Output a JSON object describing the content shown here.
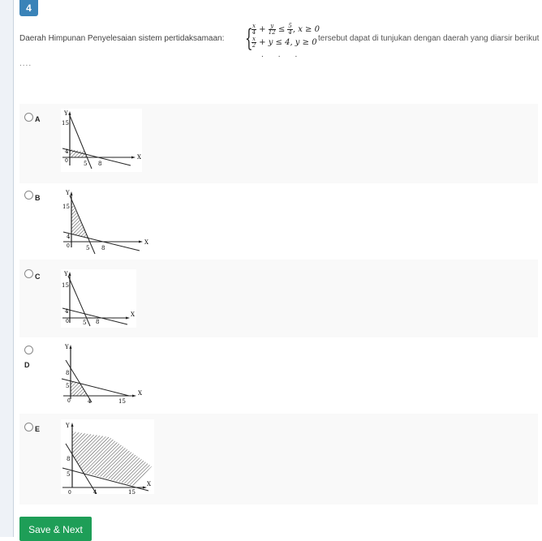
{
  "question": {
    "number": "4",
    "lead": "Daerah Himpunan Penyelesaian sistem pertidaksamaan:",
    "system": {
      "line1": {
        "t1_num": "x",
        "t1_den": "4",
        "plus": "+",
        "t2_num": "y",
        "t2_den": "12",
        "rel": "≤",
        "rhs_num": "5",
        "rhs_den": "4",
        "extra": ", x ≥ 0"
      },
      "line2": {
        "t1_num": "x",
        "t1_den": "2",
        "rest": "+ y ≤ 4",
        "extra": ", y ≥ 0"
      }
    },
    "tail": "tersebut dapat di tunjukan dengan daerah yang diarsir berikut",
    "ellipsis": "....",
    "system_dots": "..."
  },
  "options": [
    {
      "letter": "A",
      "graph": {
        "y_label": "Y",
        "x_label": "X",
        "ticks_y": [
          "15",
          "4"
        ],
        "ticks_x": [
          "5",
          "8"
        ],
        "origin": "0",
        "shaded": "below both lines"
      }
    },
    {
      "letter": "B",
      "graph": {
        "y_label": "Y",
        "x_label": "X",
        "ticks_y": [
          "15",
          "4"
        ],
        "ticks_x": [
          "5",
          "8"
        ],
        "origin": "0",
        "shaded": "between lines near y-axis"
      }
    },
    {
      "letter": "C",
      "graph": {
        "y_label": "Y",
        "x_label": "X",
        "ticks_y": [
          "15",
          "4"
        ],
        "ticks_x": [
          "5",
          "8"
        ],
        "origin": "0",
        "shaded": "small region between lines"
      }
    },
    {
      "letter": "D",
      "graph": {
        "y_label": "Y",
        "x_label": "X",
        "ticks_y": [
          "8",
          "5"
        ],
        "ticks_x": [
          "4",
          "15"
        ],
        "origin": "0",
        "shaded": "below both lines"
      }
    },
    {
      "letter": "E",
      "graph": {
        "y_label": "Y",
        "x_label": "X",
        "ticks_y": [
          "8",
          "5"
        ],
        "ticks_x": [
          "4",
          "15"
        ],
        "origin": "0",
        "shaded": "above both lines"
      }
    }
  ],
  "actions": {
    "save_next": "Save & Next"
  }
}
